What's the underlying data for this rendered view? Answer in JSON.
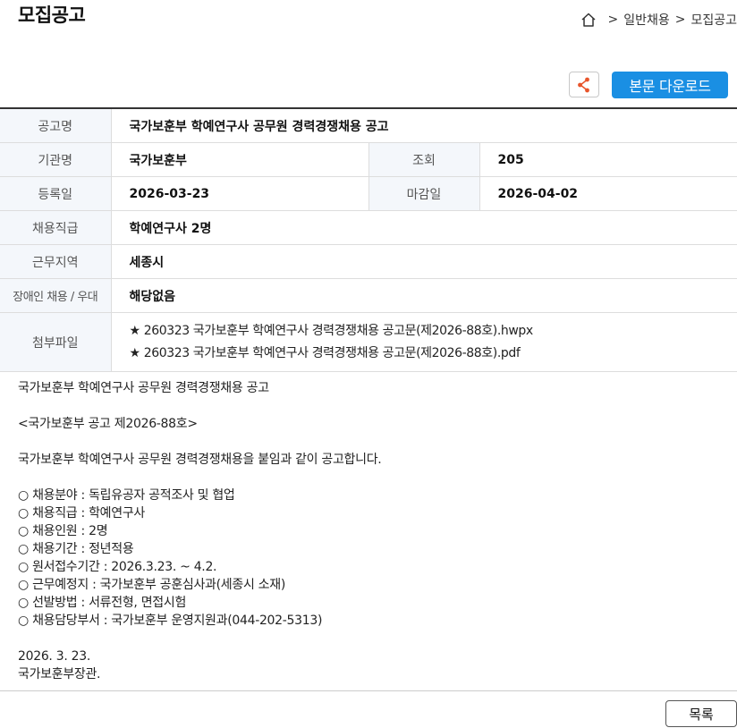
{
  "page_title": "모집공고",
  "breadcrumb": {
    "items": [
      "일반채용",
      "모집공고"
    ],
    "separator": ">"
  },
  "toolbar": {
    "share_icon": "share-icon",
    "download_label": "본문 다운로드"
  },
  "colors": {
    "accent": "#1a8fe3",
    "label_bg": "#f4f7fb"
  },
  "info": {
    "title_label": "공고명",
    "title_value": "국가보훈부 학예연구사 공무원 경력경쟁채용 공고",
    "agency_label": "기관명",
    "agency_value": "국가보훈부",
    "views_label": "조회",
    "views_value": "205",
    "registered_label": "등록일",
    "registered_value": "2026-03-23",
    "deadline_label": "마감일",
    "deadline_value": "2026-04-02",
    "position_label": "채용직급",
    "position_value": "학예연구사 2명",
    "location_label": "근무지역",
    "location_value": "세종시",
    "disabled_label": "장애인 채용 / 우대",
    "disabled_value": "해당없음",
    "attachments_label": "첨부파일",
    "attachments": [
      "★ 260323 국가보훈부 학예연구사 경력경쟁채용 공고문(제2026-88호).hwpx",
      "★ 260323 국가보훈부 학예연구사 경력경쟁채용 공고문(제2026-88호).pdf"
    ]
  },
  "body": {
    "lines": [
      "국가보훈부 학예연구사 공무원 경력경쟁채용 공고",
      "",
      "<국가보훈부 공고 제2026-88호>",
      "",
      "국가보훈부 학예연구사 공무원 경력경쟁채용을 붙임과 같이 공고합니다.",
      "",
      "○ 채용분야 : 독립유공자 공적조사 및 협업",
      "○ 채용직급 : 학예연구사",
      "○ 채용인원 : 2명",
      "○ 채용기간 : 정년적용",
      "○ 원서접수기간 : 2026.3.23. ~ 4.2.",
      "○ 근무예정지 : 국가보훈부 공훈심사과(세종시 소재)",
      "○ 선발방법 : 서류전형, 면접시험",
      "○ 채용담당부서 : 국가보훈부 운영지원과(044-202-5313)",
      "",
      "2026. 3. 23.",
      "국가보훈부장관."
    ]
  },
  "footer": {
    "list_button": "목록"
  }
}
